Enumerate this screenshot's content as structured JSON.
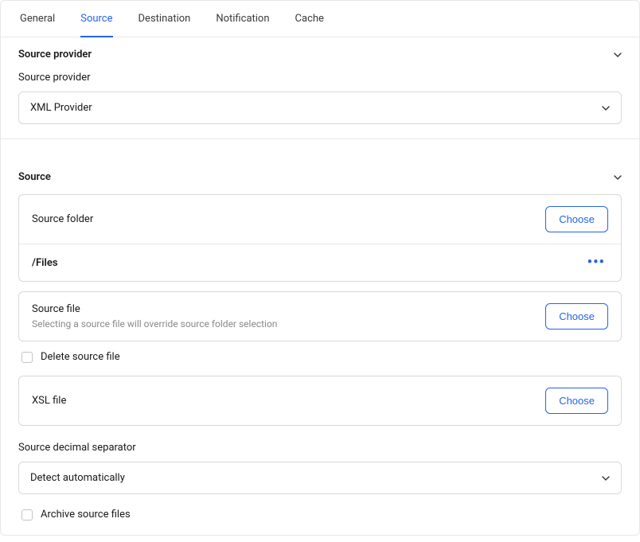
{
  "tabs": {
    "general": "General",
    "source": "Source",
    "destination": "Destination",
    "notification": "Notification",
    "cache": "Cache"
  },
  "section_provider": {
    "title": "Source provider",
    "label": "Source provider",
    "value": "XML Provider"
  },
  "section_source": {
    "title": "Source",
    "source_folder": {
      "label": "Source folder",
      "choose": "Choose",
      "value": "/Files"
    },
    "source_file": {
      "label": "Source file",
      "hint": "Selecting a source file will override source folder selection",
      "choose": "Choose"
    },
    "delete_source_file": "Delete source file",
    "xsl_file": {
      "label": "XSL file",
      "choose": "Choose"
    },
    "decimal_separator": {
      "label": "Source decimal separator",
      "value": "Detect automatically"
    },
    "archive_source_files": "Archive source files"
  }
}
